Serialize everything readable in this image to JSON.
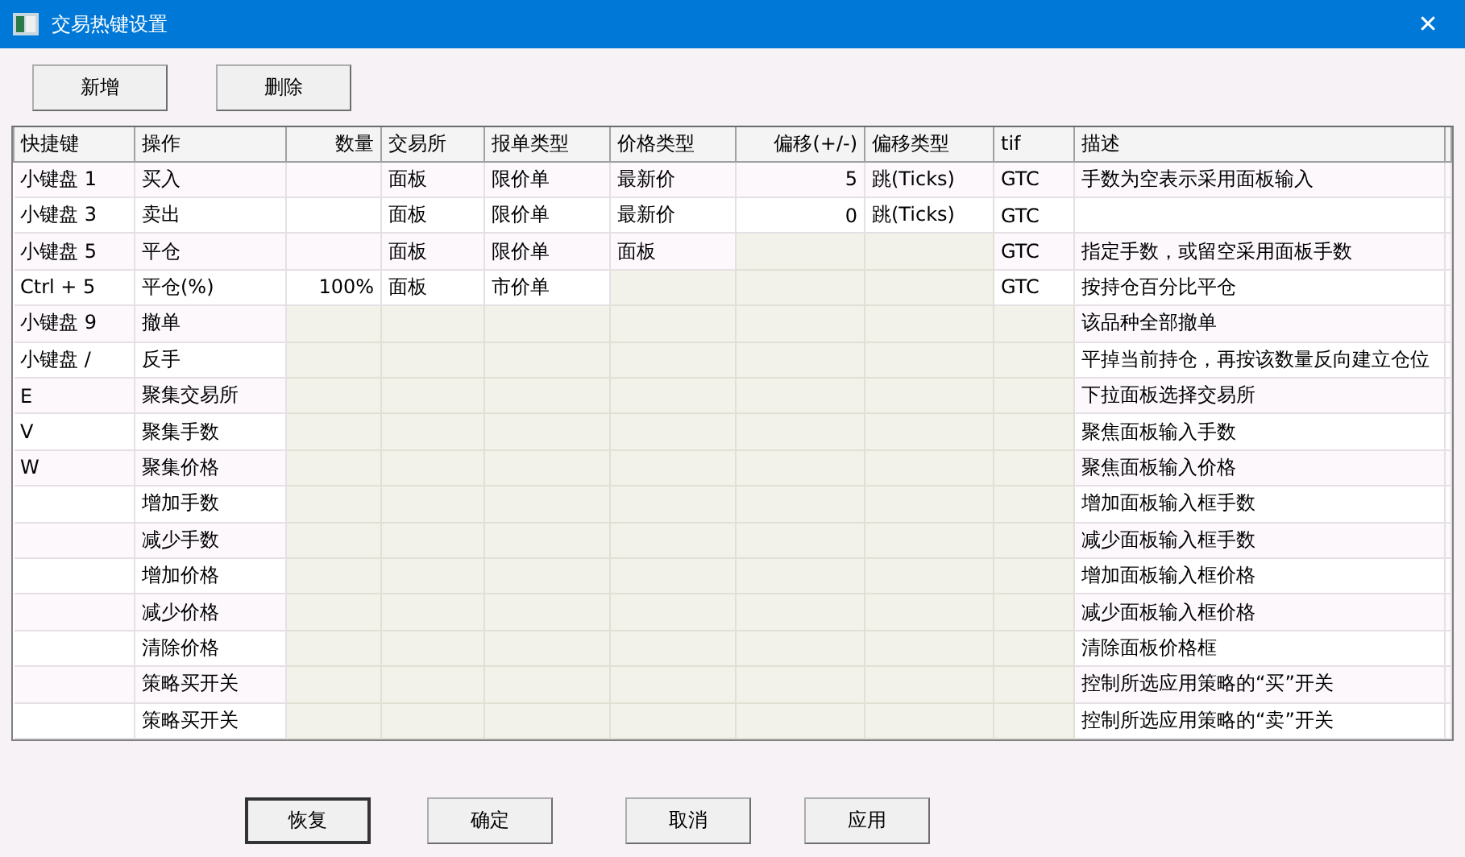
{
  "window": {
    "title": "交易热键设置",
    "close": "✕"
  },
  "toolbar": [
    {
      "label": "新增"
    },
    {
      "label": "删除"
    }
  ],
  "table": {
    "columns": [
      {
        "label": "快捷键"
      },
      {
        "label": "操作"
      },
      {
        "label": "数量"
      },
      {
        "label": "交易所"
      },
      {
        "label": "报单类型"
      },
      {
        "label": "价格类型"
      },
      {
        "label": "偏移(+/-)"
      },
      {
        "label": "偏移类型"
      },
      {
        "label": "tif"
      },
      {
        "label": "描述"
      }
    ],
    "rows": [
      {
        "cells": [
          {
            "text": "小键盘 1",
            "disabled": false
          },
          {
            "text": "买入",
            "disabled": false
          },
          {
            "disabled": false
          },
          {
            "text": "面板",
            "disabled": false
          },
          {
            "text": "限价单",
            "disabled": false
          },
          {
            "text": "最新价",
            "disabled": false
          },
          {
            "text": "5",
            "disabled": false
          },
          {
            "text": "跳(Ticks)",
            "disabled": false
          },
          {
            "text": "GTC",
            "disabled": false
          },
          {
            "text": "手数为空表示采用面板输入",
            "disabled": false
          }
        ]
      },
      {
        "cells": [
          {
            "text": "小键盘 3",
            "disabled": false
          },
          {
            "text": "卖出",
            "disabled": false
          },
          {
            "disabled": false
          },
          {
            "text": "面板",
            "disabled": false
          },
          {
            "text": "限价单",
            "disabled": false
          },
          {
            "text": "最新价",
            "disabled": false
          },
          {
            "text": "0",
            "disabled": false
          },
          {
            "text": "跳(Ticks)",
            "disabled": false
          },
          {
            "text": "GTC",
            "disabled": false
          },
          {
            "disabled": false
          }
        ]
      },
      {
        "cells": [
          {
            "text": "小键盘 5",
            "disabled": false
          },
          {
            "text": "平仓",
            "disabled": false
          },
          {
            "disabled": false
          },
          {
            "text": "面板",
            "disabled": false
          },
          {
            "text": "限价单",
            "disabled": false
          },
          {
            "text": "面板",
            "disabled": false
          },
          {
            "disabled": true
          },
          {
            "disabled": true
          },
          {
            "text": "GTC",
            "disabled": false
          },
          {
            "text": "指定手数，或留空采用面板手数",
            "disabled": false
          }
        ]
      },
      {
        "cells": [
          {
            "text": "Ctrl + 5",
            "disabled": false
          },
          {
            "text": "平仓(%)",
            "disabled": false
          },
          {
            "text": "100%",
            "disabled": false
          },
          {
            "text": "面板",
            "disabled": false
          },
          {
            "text": "市价单",
            "disabled": false
          },
          {
            "disabled": true
          },
          {
            "disabled": true
          },
          {
            "disabled": true
          },
          {
            "text": "GTC",
            "disabled": false
          },
          {
            "text": "按持仓百分比平仓",
            "disabled": false
          }
        ]
      },
      {
        "cells": [
          {
            "text": "小键盘 9",
            "disabled": false
          },
          {
            "text": "撤单",
            "disabled": false
          },
          {
            "disabled": true
          },
          {
            "disabled": true
          },
          {
            "disabled": true
          },
          {
            "disabled": true
          },
          {
            "disabled": true
          },
          {
            "disabled": true
          },
          {
            "disabled": true
          },
          {
            "text": "该品种全部撤单",
            "disabled": false
          }
        ]
      },
      {
        "cells": [
          {
            "text": "小键盘 /",
            "disabled": false
          },
          {
            "text": "反手",
            "disabled": false
          },
          {
            "disabled": true
          },
          {
            "disabled": true
          },
          {
            "disabled": true
          },
          {
            "disabled": true
          },
          {
            "disabled": true
          },
          {
            "disabled": true
          },
          {
            "disabled": true
          },
          {
            "text": "平掉当前持仓，再按该数量反向建立仓位",
            "disabled": false
          }
        ]
      },
      {
        "cells": [
          {
            "text": "E",
            "disabled": false
          },
          {
            "text": "聚集交易所",
            "disabled": false
          },
          {
            "disabled": true
          },
          {
            "disabled": true
          },
          {
            "disabled": true
          },
          {
            "disabled": true
          },
          {
            "disabled": true
          },
          {
            "disabled": true
          },
          {
            "disabled": true
          },
          {
            "text": "下拉面板选择交易所",
            "disabled": false
          }
        ]
      },
      {
        "cells": [
          {
            "text": "V",
            "disabled": false
          },
          {
            "text": "聚集手数",
            "disabled": false
          },
          {
            "disabled": true
          },
          {
            "disabled": true
          },
          {
            "disabled": true
          },
          {
            "disabled": true
          },
          {
            "disabled": true
          },
          {
            "disabled": true
          },
          {
            "disabled": true
          },
          {
            "text": "聚焦面板输入手数",
            "disabled": false
          }
        ]
      },
      {
        "cells": [
          {
            "text": "W",
            "disabled": false
          },
          {
            "text": "聚集价格",
            "disabled": false
          },
          {
            "disabled": true
          },
          {
            "disabled": true
          },
          {
            "disabled": true
          },
          {
            "disabled": true
          },
          {
            "disabled": true
          },
          {
            "disabled": true
          },
          {
            "disabled": true
          },
          {
            "text": "聚焦面板输入价格",
            "disabled": false
          }
        ]
      },
      {
        "cells": [
          {
            "disabled": false
          },
          {
            "text": "增加手数",
            "disabled": false
          },
          {
            "disabled": true
          },
          {
            "disabled": true
          },
          {
            "disabled": true
          },
          {
            "disabled": true
          },
          {
            "disabled": true
          },
          {
            "disabled": true
          },
          {
            "disabled": true
          },
          {
            "text": "增加面板输入框手数",
            "disabled": false
          }
        ]
      },
      {
        "cells": [
          {
            "disabled": false
          },
          {
            "text": "减少手数",
            "disabled": false
          },
          {
            "disabled": true
          },
          {
            "disabled": true
          },
          {
            "disabled": true
          },
          {
            "disabled": true
          },
          {
            "disabled": true
          },
          {
            "disabled": true
          },
          {
            "disabled": true
          },
          {
            "text": "减少面板输入框手数",
            "disabled": false
          }
        ]
      },
      {
        "cells": [
          {
            "disabled": false
          },
          {
            "text": "增加价格",
            "disabled": false
          },
          {
            "disabled": true
          },
          {
            "disabled": true
          },
          {
            "disabled": true
          },
          {
            "disabled": true
          },
          {
            "disabled": true
          },
          {
            "disabled": true
          },
          {
            "disabled": true
          },
          {
            "text": "增加面板输入框价格",
            "disabled": false
          }
        ]
      },
      {
        "cells": [
          {
            "disabled": false
          },
          {
            "text": "减少价格",
            "disabled": false
          },
          {
            "disabled": true
          },
          {
            "disabled": true
          },
          {
            "disabled": true
          },
          {
            "disabled": true
          },
          {
            "disabled": true
          },
          {
            "disabled": true
          },
          {
            "disabled": true
          },
          {
            "text": "减少面板输入框价格",
            "disabled": false
          }
        ]
      },
      {
        "cells": [
          {
            "disabled": false
          },
          {
            "text": "清除价格",
            "disabled": false
          },
          {
            "disabled": true
          },
          {
            "disabled": true
          },
          {
            "disabled": true
          },
          {
            "disabled": true
          },
          {
            "disabled": true
          },
          {
            "disabled": true
          },
          {
            "disabled": true
          },
          {
            "text": "清除面板价格框",
            "disabled": false
          }
        ]
      },
      {
        "cells": [
          {
            "disabled": false
          },
          {
            "text": "策略买开关",
            "disabled": false
          },
          {
            "disabled": true
          },
          {
            "disabled": true
          },
          {
            "disabled": true
          },
          {
            "disabled": true
          },
          {
            "disabled": true
          },
          {
            "disabled": true
          },
          {
            "disabled": true
          },
          {
            "text": "控制所选应用策略的“买”开关",
            "disabled": false
          }
        ]
      },
      {
        "cells": [
          {
            "disabled": false
          },
          {
            "text": "策略买开关",
            "disabled": false
          },
          {
            "disabled": true
          },
          {
            "disabled": true
          },
          {
            "disabled": true
          },
          {
            "disabled": true
          },
          {
            "disabled": true
          },
          {
            "disabled": true
          },
          {
            "disabled": true
          },
          {
            "text": "控制所选应用策略的“卖”开关",
            "disabled": false
          }
        ]
      }
    ]
  },
  "buttons": [
    {
      "label": "恢复",
      "default": true
    },
    {
      "label": "确定",
      "default": false
    },
    {
      "label": "取消",
      "default": false
    },
    {
      "label": "应用",
      "default": false
    }
  ]
}
